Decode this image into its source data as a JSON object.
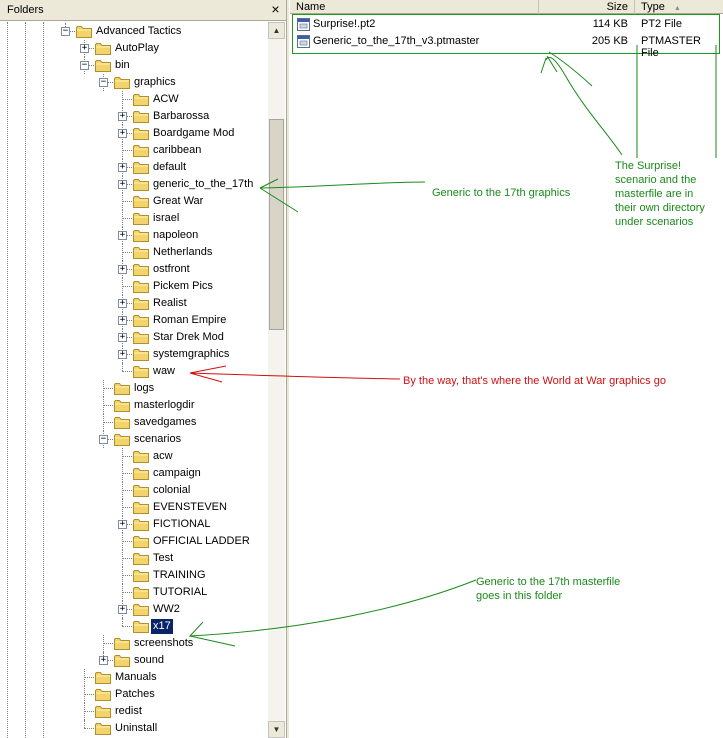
{
  "folders_pane": {
    "title": "Folders",
    "close_symbol": "×"
  },
  "tree": [
    {
      "label": "Advanced Tactics",
      "depth": 0,
      "expander": "minus"
    },
    {
      "label": "AutoPlay",
      "depth": 1,
      "expander": "plus"
    },
    {
      "label": "bin",
      "depth": 1,
      "expander": "minus"
    },
    {
      "label": "graphics",
      "depth": 2,
      "expander": "minus"
    },
    {
      "label": "ACW",
      "depth": 3,
      "expander": "none"
    },
    {
      "label": "Barbarossa",
      "depth": 3,
      "expander": "plus"
    },
    {
      "label": "Boardgame Mod",
      "depth": 3,
      "expander": "plus"
    },
    {
      "label": "caribbean",
      "depth": 3,
      "expander": "none"
    },
    {
      "label": "default",
      "depth": 3,
      "expander": "plus"
    },
    {
      "label": "generic_to_the_17th",
      "depth": 3,
      "expander": "plus"
    },
    {
      "label": "Great War",
      "depth": 3,
      "expander": "none"
    },
    {
      "label": "israel",
      "depth": 3,
      "expander": "none"
    },
    {
      "label": "napoleon",
      "depth": 3,
      "expander": "plus"
    },
    {
      "label": "Netherlands",
      "depth": 3,
      "expander": "none"
    },
    {
      "label": "ostfront",
      "depth": 3,
      "expander": "plus"
    },
    {
      "label": "Pickem Pics",
      "depth": 3,
      "expander": "none"
    },
    {
      "label": "Realist",
      "depth": 3,
      "expander": "plus"
    },
    {
      "label": "Roman Empire",
      "depth": 3,
      "expander": "plus"
    },
    {
      "label": "Star Drek Mod",
      "depth": 3,
      "expander": "plus"
    },
    {
      "label": "systemgraphics",
      "depth": 3,
      "expander": "plus"
    },
    {
      "label": "waw",
      "depth": 3,
      "expander": "none"
    },
    {
      "label": "logs",
      "depth": 2,
      "expander": "none"
    },
    {
      "label": "masterlogdir",
      "depth": 2,
      "expander": "none"
    },
    {
      "label": "savedgames",
      "depth": 2,
      "expander": "none"
    },
    {
      "label": "scenarios",
      "depth": 2,
      "expander": "minus"
    },
    {
      "label": "acw",
      "depth": 3,
      "expander": "none"
    },
    {
      "label": "campaign",
      "depth": 3,
      "expander": "none"
    },
    {
      "label": "colonial",
      "depth": 3,
      "expander": "none"
    },
    {
      "label": "EVENSTEVEN",
      "depth": 3,
      "expander": "none"
    },
    {
      "label": "FICTIONAL",
      "depth": 3,
      "expander": "plus"
    },
    {
      "label": "OFFICIAL LADDER",
      "depth": 3,
      "expander": "none"
    },
    {
      "label": "Test",
      "depth": 3,
      "expander": "none"
    },
    {
      "label": "TRAINING",
      "depth": 3,
      "expander": "none"
    },
    {
      "label": "TUTORIAL",
      "depth": 3,
      "expander": "none"
    },
    {
      "label": "WW2",
      "depth": 3,
      "expander": "plus"
    },
    {
      "label": "x17",
      "depth": 3,
      "expander": "none",
      "selected": true
    },
    {
      "label": "screenshots",
      "depth": 2,
      "expander": "none"
    },
    {
      "label": "sound",
      "depth": 2,
      "expander": "plus"
    },
    {
      "label": "Manuals",
      "depth": 1,
      "expander": "none"
    },
    {
      "label": "Patches",
      "depth": 1,
      "expander": "none"
    },
    {
      "label": "redist",
      "depth": 1,
      "expander": "none"
    },
    {
      "label": "Uninstall",
      "depth": 1,
      "expander": "none"
    }
  ],
  "scrollbar": {
    "up_symbol": "▲",
    "down_symbol": "▼"
  },
  "file_list": {
    "columns": {
      "name": "Name",
      "size": "Size",
      "type": "Type",
      "sort_indicator": "▲"
    },
    "files": [
      {
        "name": "Surprise!.pt2",
        "size": "114 KB",
        "type": "PT2 File"
      },
      {
        "name": "Generic_to_the_17th_v3.ptmaster",
        "size": "205 KB",
        "type": "PTMASTER File"
      }
    ]
  },
  "annotations": {
    "graphics_note": "Generic to the 17th graphics",
    "scenario_note_lines": [
      "The Surprise!",
      "scenario and the",
      "masterfile are in",
      "their own directory",
      "under scenarios"
    ],
    "waw_note": "By the way, that's where the World at War graphics go",
    "masterfile_note_lines": [
      "Generic to the 17th masterfile",
      "goes in this folder"
    ]
  },
  "colors": {
    "annotation_green": "#1a8a1a",
    "annotation_red": "#d01010",
    "selection": "#0a246a",
    "folder_yellow": "#f3d36b"
  }
}
